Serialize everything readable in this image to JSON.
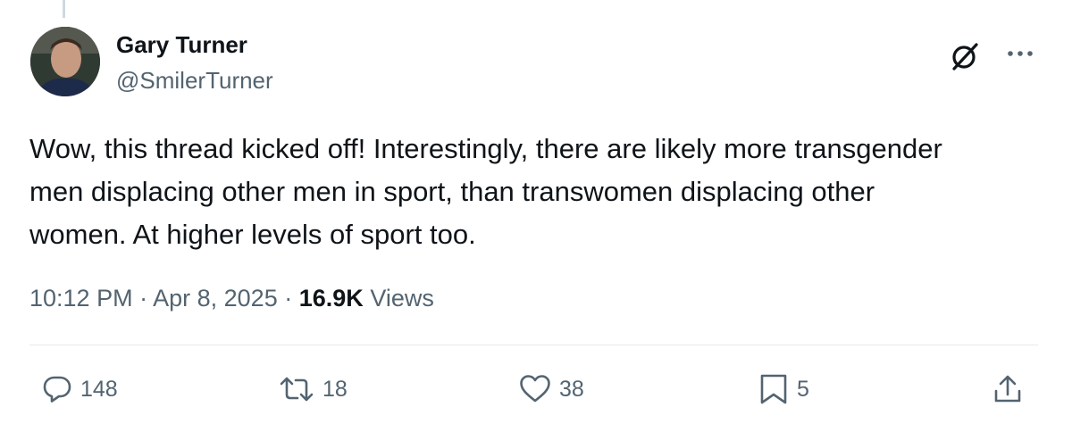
{
  "author": {
    "display_name": "Gary Turner",
    "handle": "@SmilerTurner"
  },
  "tweet": {
    "text": "Wow, this thread kicked off! Interestingly, there are likely more transgender men displacing other men in sport, than transwomen displacing other women. At higher levels of sport too."
  },
  "meta": {
    "time": "10:12 PM",
    "separator": "·",
    "date": "Apr 8, 2025",
    "views_count": "16.9K",
    "views_label": "Views"
  },
  "actions": {
    "replies": "148",
    "reposts": "18",
    "likes": "38",
    "bookmarks": "5"
  },
  "icons": {
    "grok": "grok-icon",
    "more": "more-icon",
    "reply": "reply-icon",
    "repost": "repost-icon",
    "like": "heart-icon",
    "bookmark": "bookmark-icon",
    "share": "share-icon"
  },
  "colors": {
    "text_primary": "#0f1419",
    "text_secondary": "#536471",
    "divider": "#e5e9eb"
  }
}
